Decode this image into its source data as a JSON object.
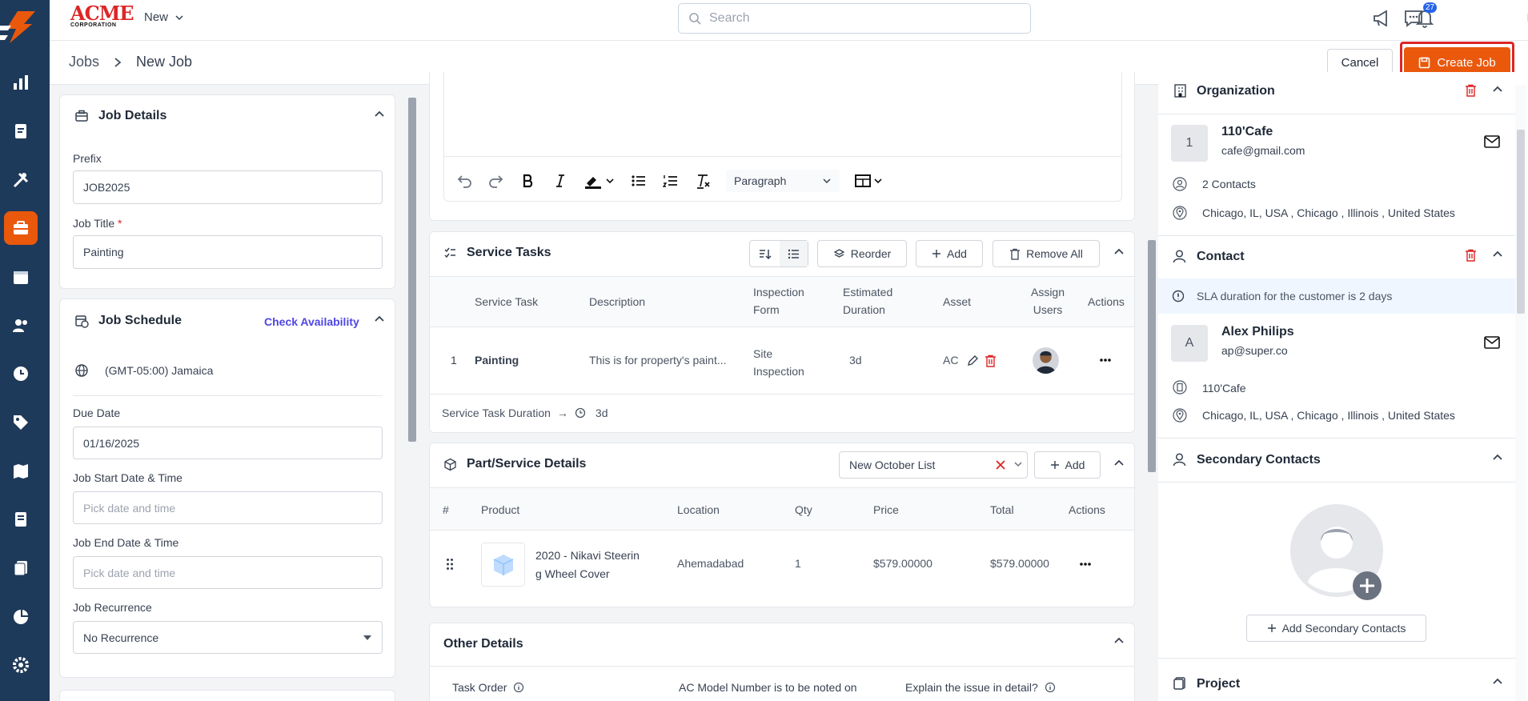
{
  "app": {
    "brand": "ACME",
    "brand_sub": "CORPORATION",
    "new_menu": "New",
    "search_placeholder": "Search",
    "notifications_count": "27"
  },
  "breadcrumb": {
    "root": "Jobs",
    "current": "New Job"
  },
  "actions": {
    "cancel": "Cancel",
    "create": "Create Job"
  },
  "job_details": {
    "title": "Job Details",
    "prefix_label": "Prefix",
    "prefix_value": "JOB2025",
    "job_title_label": "Job Title",
    "required_mark": "*",
    "job_title_value": "Painting"
  },
  "job_schedule": {
    "title": "Job Schedule",
    "check_availability": "Check Availability",
    "timezone": "(GMT-05:00) Jamaica",
    "due_date_label": "Due Date",
    "due_date_value": "01/16/2025",
    "start_label": "Job Start Date & Time",
    "start_placeholder": "Pick date and time",
    "end_label": "Job End Date & Time",
    "end_placeholder": "Pick date and time",
    "recurrence_label": "Job Recurrence",
    "recurrence_value": "No Recurrence"
  },
  "editor": {
    "paragraph_style": "Paragraph"
  },
  "service_tasks": {
    "title": "Service Tasks",
    "reorder": "Reorder",
    "add": "Add",
    "remove_all": "Remove All",
    "headers": [
      "Service Task",
      "Description",
      "Inspection Form",
      "Estimated Duration",
      "Asset",
      "Assign Users",
      "Actions"
    ],
    "rows": [
      {
        "index": "1",
        "task": "Painting",
        "description": "This is for property's paint...",
        "inspection_form": "Site Inspection",
        "duration": "3d",
        "asset": "AC"
      }
    ],
    "duration_label": "Service Task Duration",
    "duration_value": "3d"
  },
  "parts": {
    "title": "Part/Service Details",
    "list_name": "New October List",
    "add": "Add",
    "headers": [
      "#",
      "Product",
      "Location",
      "Qty",
      "Price",
      "Total",
      "Actions"
    ],
    "rows": [
      {
        "product": "2020 - Nikavi Steering Wheel Cover",
        "product_line1": "2020 - Nikavi Steerin",
        "product_line2": "g Wheel Cover",
        "location": "Ahemadabad",
        "qty": "1",
        "price": "$579.00000",
        "total": "$579.00000"
      }
    ]
  },
  "other_details": {
    "title": "Other Details",
    "task_order": "Task Order",
    "ac_model": "AC Model Number is to be noted on",
    "explain": "Explain the issue in detail?"
  },
  "organization": {
    "title": "Organization",
    "avatar": "1",
    "name": "110'Cafe",
    "email": "cafe@gmail.com",
    "contacts": "2 Contacts",
    "address": "Chicago, IL, USA , Chicago , Illinois , United States"
  },
  "contact": {
    "title": "Contact",
    "sla_notice": "SLA duration for the customer is 2 days",
    "avatar": "A",
    "name": "Alex Philips",
    "email": "ap@super.co",
    "org": "110'Cafe",
    "address": "Chicago, IL, USA , Chicago , Illinois , United States"
  },
  "secondary_contacts": {
    "title": "Secondary Contacts",
    "add": "Add Secondary Contacts"
  },
  "project": {
    "title": "Project"
  },
  "colors": {
    "accent": "#ea580c",
    "rail": "#1e3a5a",
    "link": "#4f46e5",
    "danger": "#dc2626"
  }
}
